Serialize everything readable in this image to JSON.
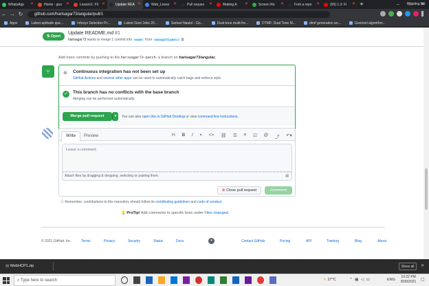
{
  "browser": {
    "tabs": [
      {
        "label": "WhatsApp",
        "color": "#25d366"
      },
      {
        "label": "Home - goo",
        "color": "#ea4335"
      },
      {
        "label": "Lesson1: Fli",
        "color": "#e53935"
      },
      {
        "label": "Update REA",
        "color": "#24292f"
      },
      {
        "label": "Web_Lesso",
        "color": "#4285f4"
      },
      {
        "label": "Pull reques",
        "color": "#24292f"
      },
      {
        "label": "Making A",
        "color": "#ff0000"
      },
      {
        "label": "Screen Re",
        "color": "#34a853"
      },
      {
        "label": "Fork a repo",
        "color": "#24292f"
      },
      {
        "label": "(56) 1.3: Fi",
        "color": "#ff0000"
      }
    ],
    "active_tab_index": 3,
    "new_tab": "+",
    "url": "github.com/harisagar73/angular/pull/1",
    "bookmarks": [
      "Apps",
      "Latest aptitude que...",
      "Infosys Selection Pr...",
      "Latest Govt Jobs 20...",
      "Sarkari Naukri - Go...",
      "Dual-tone multi-fre...",
      "DTMF: Dual Tone M...",
      "dtmf generation an...",
      "Goertzel algorithm..."
    ],
    "reading_list": "Reading list"
  },
  "pr": {
    "status": "Open",
    "title": "Update README.md",
    "number": "#1",
    "subtitle_user": "harisagar73",
    "subtitle_text": "wants to merge 1 commit into",
    "base_branch": "master",
    "from_text": "from",
    "head_branch": "harisagar73-patch-1"
  },
  "commits_hint": {
    "prefix": "Add more commits by pushing to the",
    "branch": "harisagar73-patch-1",
    "middle": "branch on",
    "repo": "harisagar73/angular."
  },
  "ci": {
    "title": "Continuous integration has not been set up",
    "link1": "GitHub Actions",
    "and": "and",
    "link2": "several other apps",
    "rest": "can be used to automatically catch bugs and enforce style."
  },
  "conflicts": {
    "title": "This branch has no conflicts with the base branch",
    "subtitle": "Merging can be performed automatically."
  },
  "merge": {
    "button": "Merge pull request",
    "hint_prefix": "You can also",
    "hint_link1": "open this in GitHub Desktop",
    "hint_or": "or view",
    "hint_link2": "command line instructions."
  },
  "comment": {
    "tab_write": "Write",
    "tab_preview": "Preview",
    "placeholder": "Leave a comment",
    "attach_hint": "Attach files by dragging & dropping, selecting or pasting them.",
    "close_button": "Close pull request",
    "comment_button": "Comment",
    "toolbar_h": "H",
    "toolbar_b": "B",
    "toolbar_i": "I"
  },
  "contrib": {
    "prefix": "Remember, contributions to this repository should follow its",
    "link1": "contributing guidelines",
    "and": "and",
    "link2": "code of conduct."
  },
  "protip": {
    "label": "ProTip!",
    "text": "Add comments to specific lines under",
    "link": "Files changed."
  },
  "footer": {
    "copyright": "© 2021 GitHub, Inc.",
    "links_left": [
      "Terms",
      "Privacy",
      "Security",
      "Status",
      "Docs"
    ],
    "links_right": [
      "Contact GitHub",
      "Pricing",
      "API",
      "Training",
      "Blog",
      "About"
    ]
  },
  "download": {
    "file": "WebHCP1.zip",
    "show_all": "Show all"
  },
  "taskbar": {
    "search_placeholder": "Type here to search",
    "weather": "27°C",
    "lang": "ENG",
    "time": "10:22 PM",
    "date": "8/30/2021"
  }
}
